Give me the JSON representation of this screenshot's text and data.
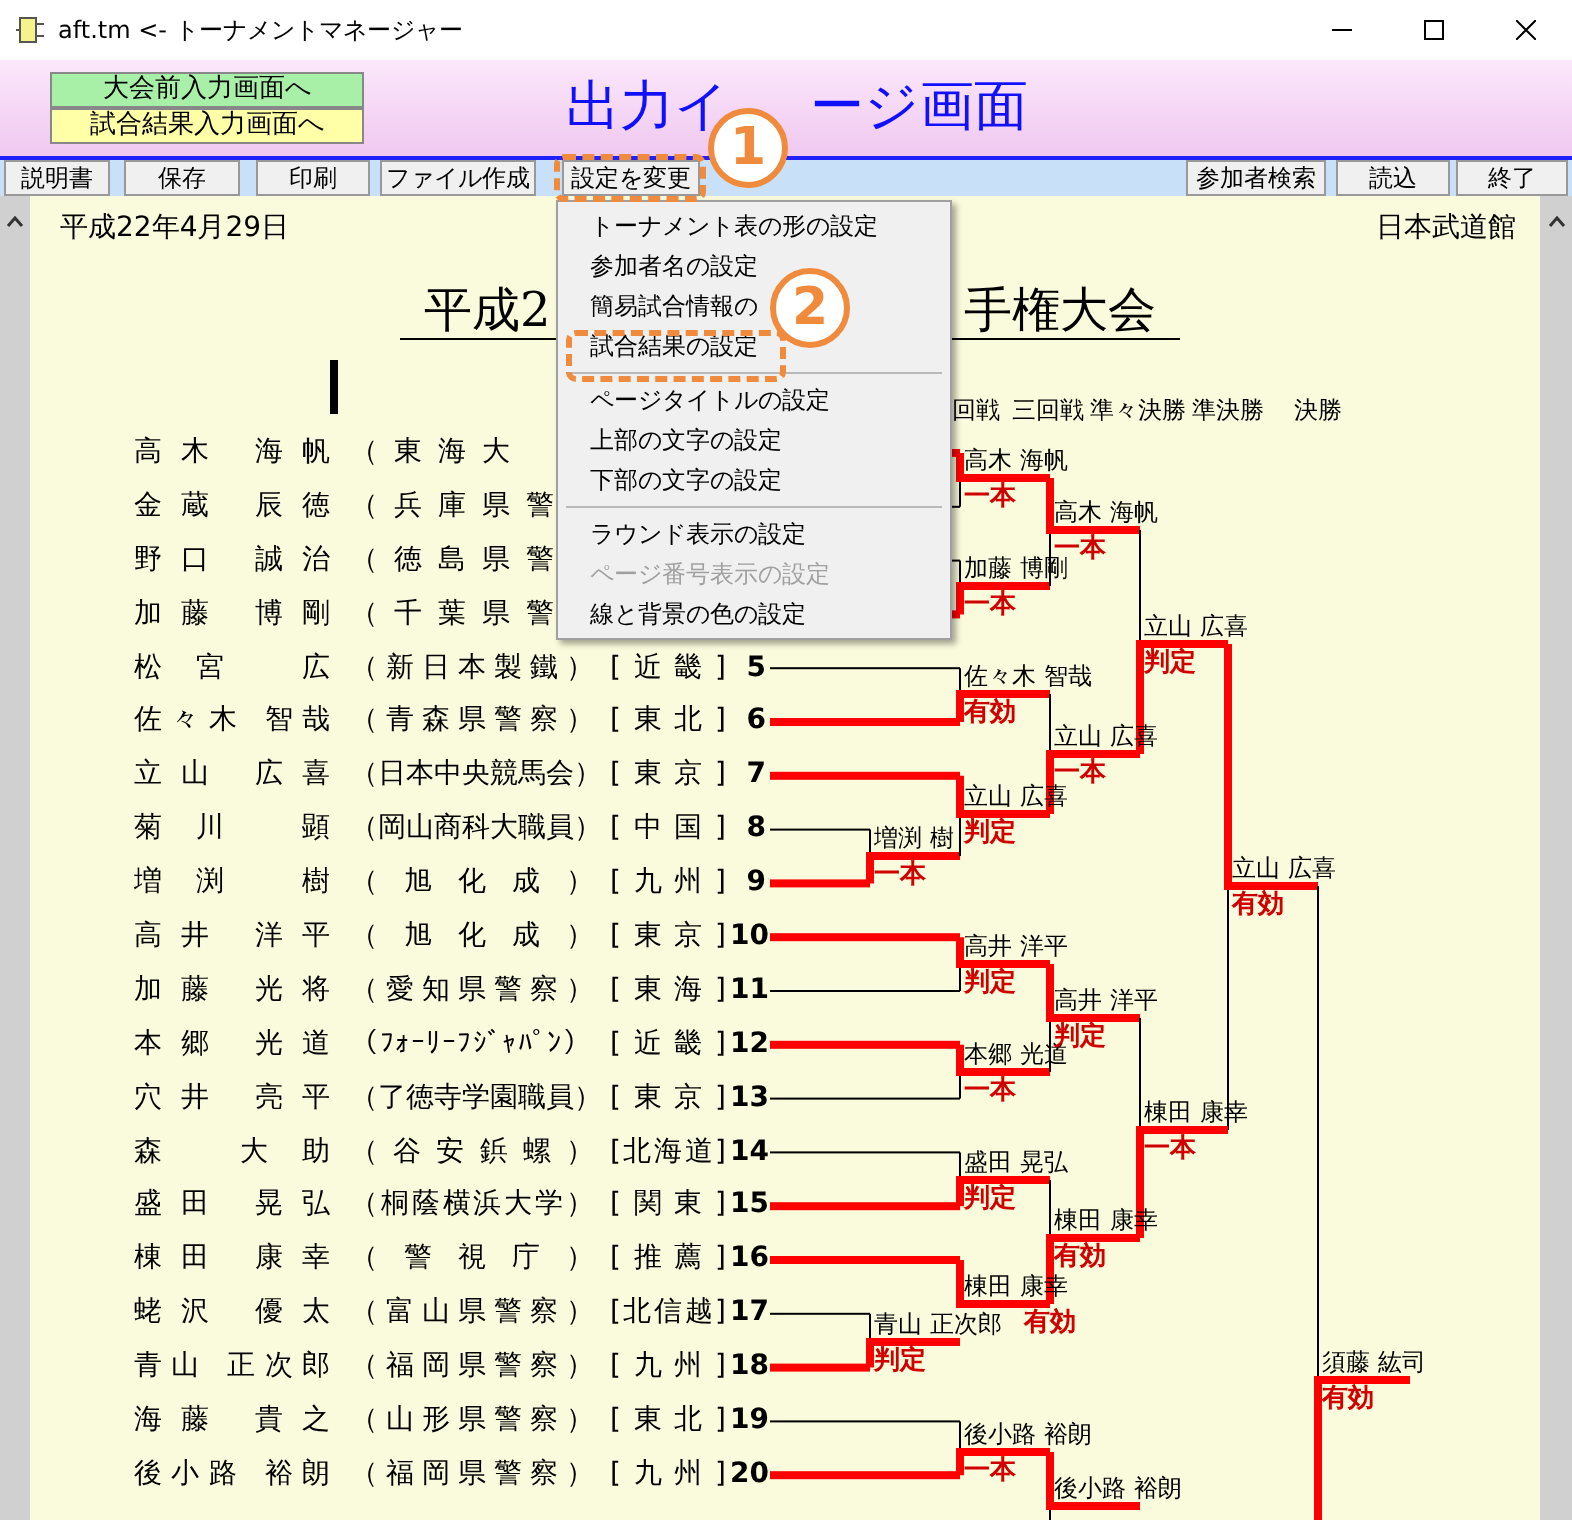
{
  "window": {
    "title": "aft.tm <- トーナメントマネージャー"
  },
  "header": {
    "nav_buttons": [
      {
        "label": "大会前入力画面へ",
        "color": "#a8f0a8"
      },
      {
        "label": "試合結果入力画面へ",
        "color": "#ffffa8"
      }
    ],
    "title_parts": [
      "出力イ",
      "ージ画面"
    ]
  },
  "toolbar": {
    "left": [
      "説明書",
      "保存",
      "印刷",
      "ファイル作成",
      "設定を変更"
    ],
    "right": [
      "参加者検索",
      "読込",
      "終了"
    ]
  },
  "menu": {
    "items": [
      {
        "kind": "item",
        "label": "トーナメント表の形の設定",
        "disabled": false
      },
      {
        "kind": "item",
        "label": "参加者名の設定",
        "disabled": false
      },
      {
        "kind": "item",
        "label": "簡易試合情報の",
        "disabled": false
      },
      {
        "kind": "item",
        "label": "試合結果の設定",
        "disabled": false
      },
      {
        "kind": "separator"
      },
      {
        "kind": "item",
        "label": "ページタイトルの設定",
        "disabled": false
      },
      {
        "kind": "item",
        "label": "上部の文字の設定",
        "disabled": false
      },
      {
        "kind": "item",
        "label": "下部の文字の設定",
        "disabled": false
      },
      {
        "kind": "separator"
      },
      {
        "kind": "item",
        "label": "ラウンド表示の設定",
        "disabled": false
      },
      {
        "kind": "item",
        "label": "ページ番号表示の設定",
        "disabled": true
      },
      {
        "kind": "item",
        "label": "線と背景の色の設定",
        "disabled": false
      }
    ]
  },
  "callouts": [
    {
      "label": "1"
    },
    {
      "label": "2"
    }
  ],
  "page": {
    "date": "平成22年4月29日",
    "venue": "日本武道館",
    "title_parts": [
      "平成2",
      "手権大会"
    ],
    "rounds": [
      "回戦",
      "三回戦",
      "準々決勝",
      "準決勝",
      "決勝"
    ],
    "participants": [
      {
        "name": "高木 海帆",
        "affiliation": "（東海大",
        "advanced": true
      },
      {
        "name": "金蔵 辰徳",
        "affiliation": "（兵庫県警",
        "advanced": false
      },
      {
        "name": "野口 誠治",
        "affiliation": "（徳島県警",
        "advanced": false
      },
      {
        "name": "加藤 博剛",
        "affiliation": "（千葉県警",
        "advanced": true
      },
      {
        "name": "松宮 広",
        "affiliation": "（新日本製鐵）",
        "region": "[近畿]",
        "number": "5",
        "advanced": false
      },
      {
        "name": "佐々木 智哉",
        "affiliation": "（青森県警察）",
        "region": "[東北]",
        "number": "6",
        "advanced": true
      },
      {
        "name": "立山 広喜",
        "affiliation": "（日本中央競馬会）",
        "region": "[東京]",
        "number": "7",
        "advanced": true
      },
      {
        "name": "菊川 顕",
        "affiliation": "（岡山商科大職員）",
        "region": "[中国]",
        "number": "8",
        "advanced": false
      },
      {
        "name": "増渕 樹",
        "affiliation": "（旭化成）",
        "region": "[九州]",
        "number": "9",
        "advanced": true
      },
      {
        "name": "高井 洋平",
        "affiliation": "（旭化成）",
        "region": "[東京]",
        "number": "10",
        "advanced": true
      },
      {
        "name": "加藤 光将",
        "affiliation": "（愛知県警察）",
        "region": "[東海]",
        "number": "11",
        "advanced": false
      },
      {
        "name": "本郷 光道",
        "affiliation": "（ﾌｫｰﾘｰﾌｼﾞｬﾊﾟﾝ）",
        "region": "[近畿]",
        "number": "12",
        "advanced": true
      },
      {
        "name": "穴井 亮平",
        "affiliation": "（了徳寺学園職員）",
        "region": "[東京]",
        "number": "13",
        "advanced": false
      },
      {
        "name": "森 大助",
        "affiliation": "（谷安鋲螺）",
        "region": "[北海道]",
        "number": "14",
        "advanced": false
      },
      {
        "name": "盛田 晃弘",
        "affiliation": "（桐蔭横浜大学）",
        "region": "[関東]",
        "number": "15",
        "advanced": true
      },
      {
        "name": "棟田 康幸",
        "affiliation": "（警視庁）",
        "region": "[推薦]",
        "number": "16",
        "advanced": true
      },
      {
        "name": "蛯沢 優太",
        "affiliation": "（富山県警察）",
        "region": "[北信越]",
        "number": "17",
        "advanced": false
      },
      {
        "name": "青山 正次郎",
        "affiliation": "（福岡県警察）",
        "region": "[九州]",
        "number": "18",
        "advanced": true
      },
      {
        "name": "海藤 貴之",
        "affiliation": "（山形県警察）",
        "region": "[東北]",
        "number": "19",
        "advanced": false
      },
      {
        "name": "後小路 裕朗",
        "affiliation": "（福岡県警察）",
        "region": "[九州]",
        "number": "20",
        "advanced": true
      }
    ],
    "matches": [
      {
        "winner": "高木 海帆",
        "result": "一本",
        "top_wins": true
      },
      {
        "winner": "加藤 博剛",
        "result": "一本",
        "top_wins": false
      },
      {
        "winner": "佐々木 智哉",
        "result": "有効",
        "top_wins": false
      },
      {
        "winner": "増渕 樹",
        "result": "一本",
        "top_wins": false
      },
      {
        "winner": "立山 広喜",
        "result": "判定",
        "top_wins": true
      },
      {
        "winner": "高木 海帆",
        "result": "一本",
        "top_wins": true
      },
      {
        "winner": "立山 広喜",
        "result": "一本",
        "top_wins": false
      },
      {
        "winner": "立山 広喜",
        "result": "判定",
        "top_wins": false
      },
      {
        "winner": "立山 広喜",
        "result": "有効",
        "top_wins": true
      },
      {
        "winner": "高井 洋平",
        "result": "判定",
        "top_wins": true
      },
      {
        "winner": "本郷 光道",
        "result": "一本",
        "top_wins": true
      },
      {
        "winner": "高井 洋平",
        "result": "判定",
        "top_wins": true
      },
      {
        "winner": "盛田 晃弘",
        "result": "判定",
        "top_wins": false
      },
      {
        "winner": "青山 正次郎",
        "result": "判定",
        "top_wins": false
      },
      {
        "winner": "棟田 康幸",
        "result": "有効",
        "top_wins": true
      },
      {
        "winner": "棟田 康幸",
        "result": "有効",
        "top_wins": false
      },
      {
        "winner": "棟田 康幸",
        "result": "一本",
        "top_wins": false
      },
      {
        "winner": "後小路 裕朗",
        "result": "一本",
        "top_wins": false
      },
      {
        "winner": "後小路 裕朗",
        "top_wins": true
      },
      {
        "winner": "須藤 紘司",
        "result": "有効",
        "top_wins": false
      }
    ]
  }
}
